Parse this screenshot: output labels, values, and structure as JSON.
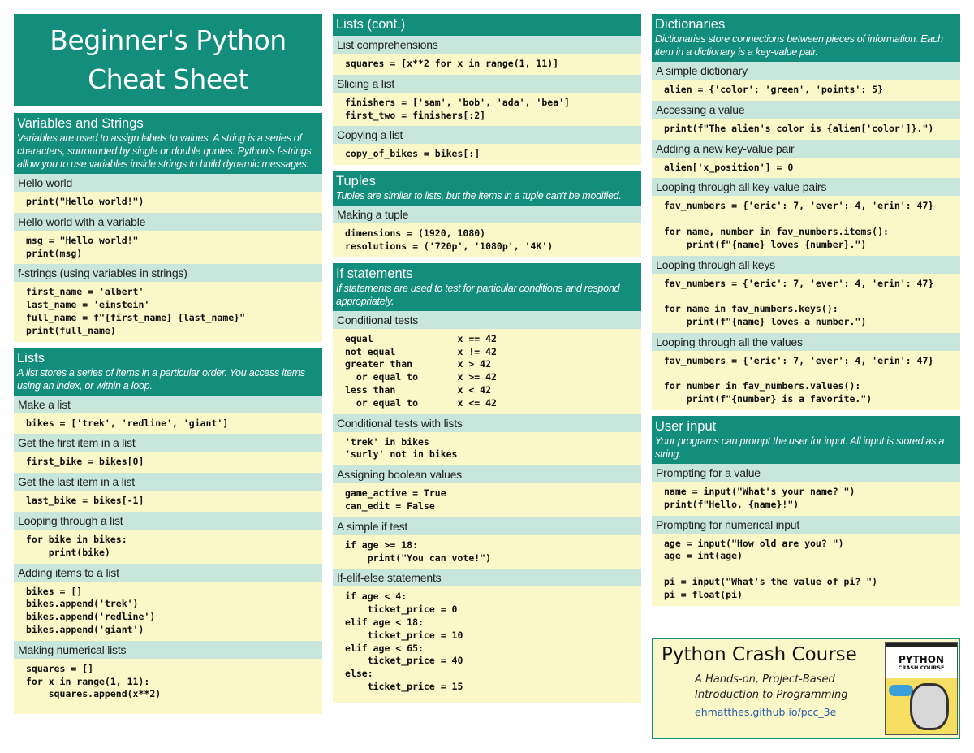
{
  "title": {
    "line1": "Beginner's Python",
    "line2": "Cheat Sheet"
  },
  "colors": {
    "teal": "#138d7c",
    "subhead": "#c8e6dc",
    "code_bg": "#faf7c8",
    "link": "#2a5fa8"
  },
  "variables": {
    "title": "Variables and Strings",
    "desc": "Variables are used to assign labels to values. A string is a series of characters, surrounded by single or double quotes. Python's f-strings allow you to use variables inside strings to build dynamic messages.",
    "items": [
      {
        "head": "Hello world",
        "code": "print(\"Hello world!\")"
      },
      {
        "head": "Hello world with a variable",
        "code": "msg = \"Hello world!\"\nprint(msg)"
      },
      {
        "head": "f-strings (using variables in strings)",
        "code": "first_name = 'albert'\nlast_name = 'einstein'\nfull_name = f\"{first_name} {last_name}\"\nprint(full_name)"
      }
    ]
  },
  "lists": {
    "title": "Lists",
    "desc": "A list stores a series of items in a particular order. You access items using an index, or within a loop.",
    "items": [
      {
        "head": "Make a list",
        "code": "bikes = ['trek', 'redline', 'giant']"
      },
      {
        "head": "Get the first item in a list",
        "code": "first_bike = bikes[0]"
      },
      {
        "head": "Get the last item in a list",
        "code": "last_bike = bikes[-1]"
      },
      {
        "head": "Looping through a list",
        "code": "for bike in bikes:\n    print(bike)"
      },
      {
        "head": "Adding items to a list",
        "code": "bikes = []\nbikes.append('trek')\nbikes.append('redline')\nbikes.append('giant')"
      },
      {
        "head": "Making numerical lists",
        "code": "squares = []\nfor x in range(1, 11):\n    squares.append(x**2)"
      }
    ]
  },
  "lists_cont": {
    "title": "Lists (cont.)",
    "items": [
      {
        "head": "List comprehensions",
        "code": "squares = [x**2 for x in range(1, 11)]"
      },
      {
        "head": "Slicing a list",
        "code": "finishers = ['sam', 'bob', 'ada', 'bea']\nfirst_two = finishers[:2]"
      },
      {
        "head": "Copying a list",
        "code": "copy_of_bikes = bikes[:]"
      }
    ]
  },
  "tuples": {
    "title": "Tuples",
    "desc": "Tuples are similar to lists, but the items in a tuple can't be modified.",
    "items": [
      {
        "head": "Making a tuple",
        "code": "dimensions = (1920, 1080)\nresolutions = ('720p', '1080p', '4K')"
      }
    ]
  },
  "ifs": {
    "title": "If statements",
    "desc": "If statements are used to test for particular conditions and respond appropriately.",
    "items": [
      {
        "head": "Conditional tests",
        "code": "equal               x == 42\nnot equal           x != 42\ngreater than        x > 42\n  or equal to       x >= 42\nless than           x < 42\n  or equal to       x <= 42"
      },
      {
        "head": "Conditional tests with lists",
        "code": "'trek' in bikes\n'surly' not in bikes"
      },
      {
        "head": "Assigning boolean values",
        "code": "game_active = True\ncan_edit = False"
      },
      {
        "head": "A simple if test",
        "code": "if age >= 18:\n    print(\"You can vote!\")"
      },
      {
        "head": "If-elif-else statements",
        "code": "if age < 4:\n    ticket_price = 0\nelif age < 18:\n    ticket_price = 10\nelif age < 65:\n    ticket_price = 40\nelse:\n    ticket_price = 15\n"
      }
    ]
  },
  "dicts": {
    "title": "Dictionaries",
    "desc": "Dictionaries store connections between pieces of information. Each item in a dictionary is a key-value pair.",
    "items": [
      {
        "head": "A simple dictionary",
        "code": "alien = {'color': 'green', 'points': 5}"
      },
      {
        "head": "Accessing a value",
        "code": "print(f\"The alien's color is {alien['color']}.\")"
      },
      {
        "head": "Adding a new key-value pair",
        "code": "alien['x_position'] = 0"
      },
      {
        "head": "Looping through all key-value pairs",
        "code": "fav_numbers = {'eric': 7, 'ever': 4, 'erin': 47}\n\nfor name, number in fav_numbers.items():\n    print(f\"{name} loves {number}.\")"
      },
      {
        "head": "Looping through all keys",
        "code": "fav_numbers = {'eric': 7, 'ever': 4, 'erin': 47}\n\nfor name in fav_numbers.keys():\n    print(f\"{name} loves a number.\")"
      },
      {
        "head": "Looping through all the values",
        "code": "fav_numbers = {'eric': 7, 'ever': 4, 'erin': 47}\n\nfor number in fav_numbers.values():\n    print(f\"{number} is a favorite.\")"
      }
    ]
  },
  "input": {
    "title": "User input",
    "desc": "Your programs can prompt the user for input. All input is stored as a string.",
    "items": [
      {
        "head": "Prompting for a value",
        "code": "name = input(\"What's your name? \")\nprint(f\"Hello, {name}!\")"
      },
      {
        "head": "Prompting for numerical input",
        "code": "age = input(\"How old are you? \")\nage = int(age)\n\npi = input(\"What's the value of pi? \")\npi = float(pi)\n"
      }
    ]
  },
  "promo": {
    "title": "Python Crash Course",
    "subtitle_line1": "A Hands-on, Project-Based",
    "subtitle_line2": "Introduction to Programming",
    "link": "ehmatthes.github.io/pcc_3e",
    "book_title1": "PYTHON",
    "book_title2": "CRASH COURSE"
  }
}
